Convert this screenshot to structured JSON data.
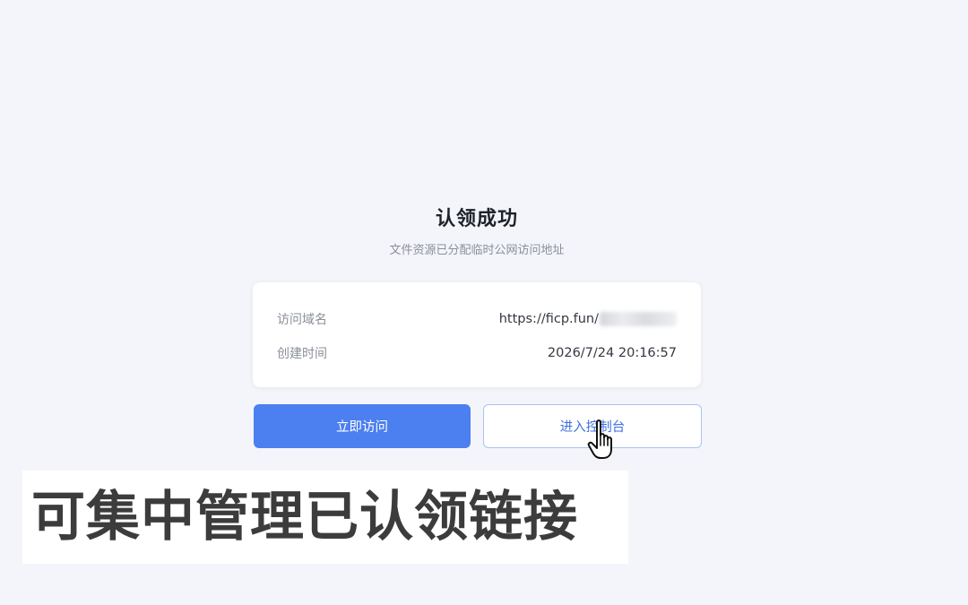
{
  "header": {
    "title": "认领成功",
    "subtitle": "文件资源已分配临时公网访问地址"
  },
  "info": {
    "domain_label": "访问域名",
    "domain_value": "https://ficp.fun/",
    "created_label": "创建时间",
    "created_value": "2026/7/24 20:16:57"
  },
  "actions": {
    "visit_label": "立即访问",
    "console_label": "进入控制台"
  },
  "caption": {
    "text": "可集中管理已认领链接"
  },
  "icons": {
    "cursor": "hand-pointer-icon"
  },
  "colors": {
    "background": "#f4f5fa",
    "primary": "#4c7ff0",
    "secondary_border": "#a9c1f4",
    "secondary_text": "#3d6fe0",
    "caption_text": "#3c3c3c"
  }
}
